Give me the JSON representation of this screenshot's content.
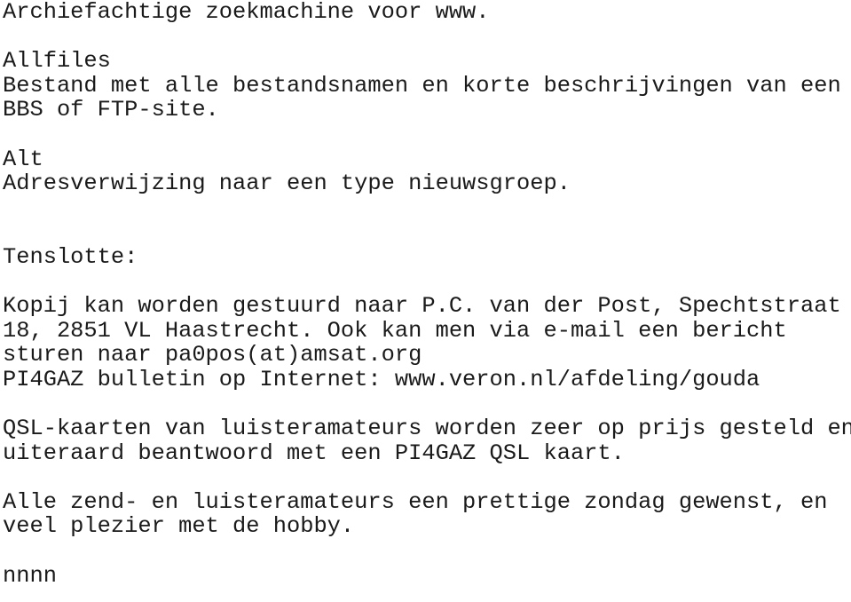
{
  "document": {
    "type": "plain-text-document",
    "background_color": "#ffffff",
    "text_color": "#1a1a1a",
    "lines": [
      "Archiefachtige zoekmachine voor www.",
      "",
      "Allfiles",
      "Bestand met alle bestandsnamen en korte beschrijvingen van een",
      "BBS of FTP-site.",
      "",
      "Alt",
      "Adresverwijzing naar een type nieuwsgroep.",
      "",
      "",
      "Tenslotte:",
      "",
      "Kopij kan worden gestuurd naar P.C. van der Post, Spechtstraat",
      "18, 2851 VL Haastrecht. Ook kan men via e-mail een bericht",
      "sturen naar pa0pos(at)amsat.org",
      "PI4GAZ bulletin op Internet: www.veron.nl/afdeling/gouda",
      "",
      "QSL-kaarten van luisteramateurs worden zeer op prijs gesteld en",
      "uiteraard beantwoord met een PI4GAZ QSL kaart.",
      "",
      "Alle zend- en luisteramateurs een prettige zondag gewenst, en",
      "veel plezier met de hobby.",
      "",
      "nnnn"
    ]
  }
}
